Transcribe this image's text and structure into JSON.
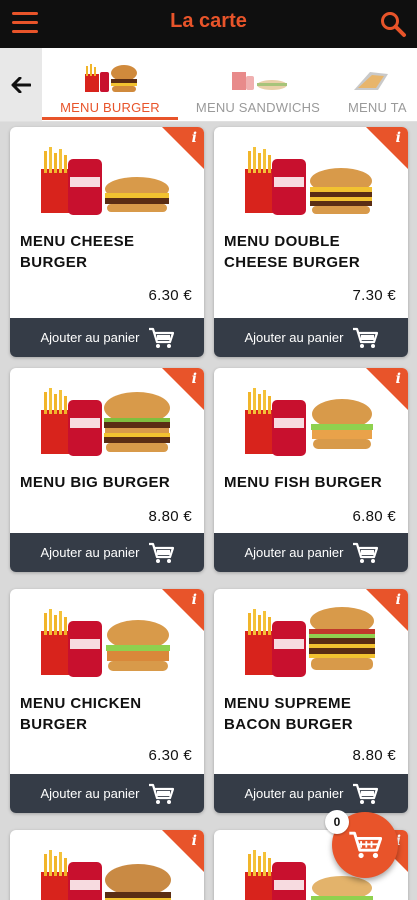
{
  "header": {
    "title": "La carte",
    "menu_icon": "hamburger-icon",
    "search_icon": "search-icon",
    "accent_color": "#e8542a",
    "bar_color": "#0f0f0f"
  },
  "tabs": {
    "back_icon": "arrow-left-icon",
    "items": [
      {
        "label": "MENU BURGER",
        "active": true
      },
      {
        "label": "MENU SANDWICHS",
        "active": false
      },
      {
        "label": "MENU TA",
        "active": false
      }
    ]
  },
  "products": [
    {
      "name_line1": "MENU CHEESE",
      "name_line2": "BURGER",
      "price": "6.30 €",
      "button": "Ajouter au panier",
      "info": "i"
    },
    {
      "name_line1": "MENU DOUBLE",
      "name_line2": "CHEESE BURGER",
      "price": "7.30 €",
      "button": "Ajouter au panier",
      "info": "i"
    },
    {
      "name_line1": "MENU BIG BURGER",
      "name_line2": "",
      "price": "8.80 €",
      "button": "Ajouter au panier",
      "info": "i"
    },
    {
      "name_line1": "MENU FISH BURGER",
      "name_line2": "",
      "price": "6.80 €",
      "button": "Ajouter au panier",
      "info": "i"
    },
    {
      "name_line1": "MENU CHICKEN",
      "name_line2": "BURGER",
      "price": "6.30 €",
      "button": "Ajouter au panier",
      "info": "i"
    },
    {
      "name_line1": "MENU SUPREME",
      "name_line2": "BACON BURGER",
      "price": "8.80 €",
      "button": "Ajouter au panier",
      "info": "i"
    },
    {
      "name_line1": "",
      "name_line2": "",
      "price": "",
      "button": "",
      "info": "i"
    },
    {
      "name_line1": "",
      "name_line2": "",
      "price": "",
      "button": "",
      "info": "i"
    }
  ],
  "cart": {
    "count": "0",
    "icon": "cart-icon"
  }
}
